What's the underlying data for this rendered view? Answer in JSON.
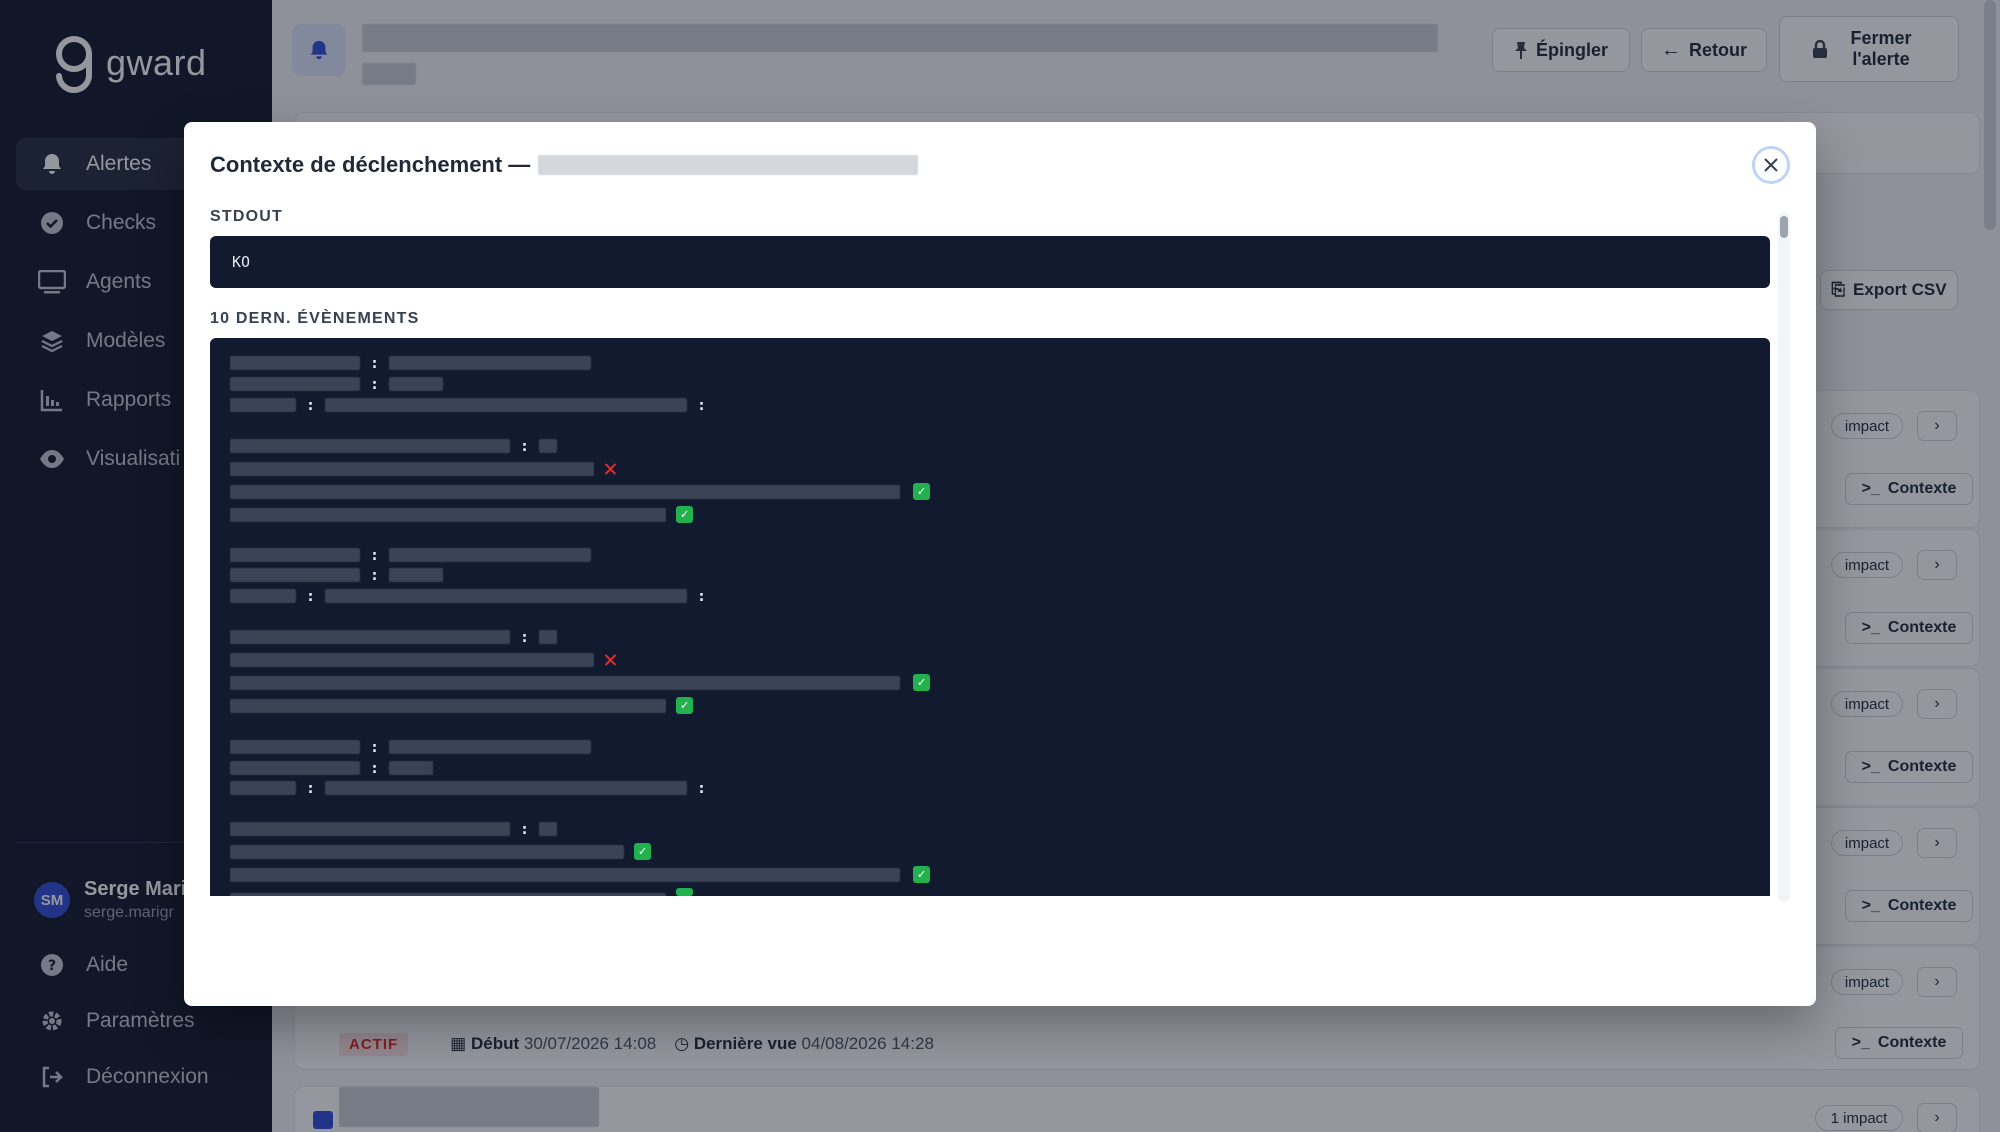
{
  "sidebar": {
    "logo_text": "gward",
    "nav": [
      {
        "label": "Alertes",
        "icon": "bell-icon",
        "active": true
      },
      {
        "label": "Checks",
        "icon": "check-circle-icon"
      },
      {
        "label": "Agents",
        "icon": "monitor-icon"
      },
      {
        "label": "Modèles",
        "icon": "layers-icon"
      },
      {
        "label": "Rapports",
        "icon": "chart-icon"
      },
      {
        "label": "Visualisati",
        "icon": "eye-icon"
      }
    ],
    "user": {
      "initials": "SM",
      "name": "Serge Mari",
      "email": "serge.marigr"
    },
    "footer": [
      {
        "label": "Aide",
        "icon": "help-icon"
      },
      {
        "label": "Paramètres",
        "icon": "gear-icon"
      },
      {
        "label": "Déconnexion",
        "icon": "logout-icon"
      }
    ]
  },
  "header": {
    "pin_label": "Épingler",
    "back_label": "Retour",
    "close_alert_label": "Fermer l'alerte"
  },
  "toolbar": {
    "export_label": "Export CSV"
  },
  "rows": {
    "impact_label": "impact",
    "context_label": "Contexte",
    "last_impact_label": "1 impact"
  },
  "status_row": {
    "badge": "ACTIF",
    "start_label": "Début",
    "start_value": "30/07/2026 14:08",
    "last_seen_label": "Dernière vue",
    "last_seen_value": "04/08/2026 14:28"
  },
  "modal": {
    "title": "Contexte de déclenchement —",
    "stdout_label": "STDOUT",
    "stdout_value": "KO",
    "events_label": "10 DERN. ÉVÈNEMENTS"
  },
  "colors": {
    "sidebar_bg": "#111729",
    "code_bg": "#111a2e",
    "accent": "#2f4bd6",
    "ok": "#22b14c",
    "ko": "#ef2b2b",
    "active_badge": "#dc2626"
  }
}
